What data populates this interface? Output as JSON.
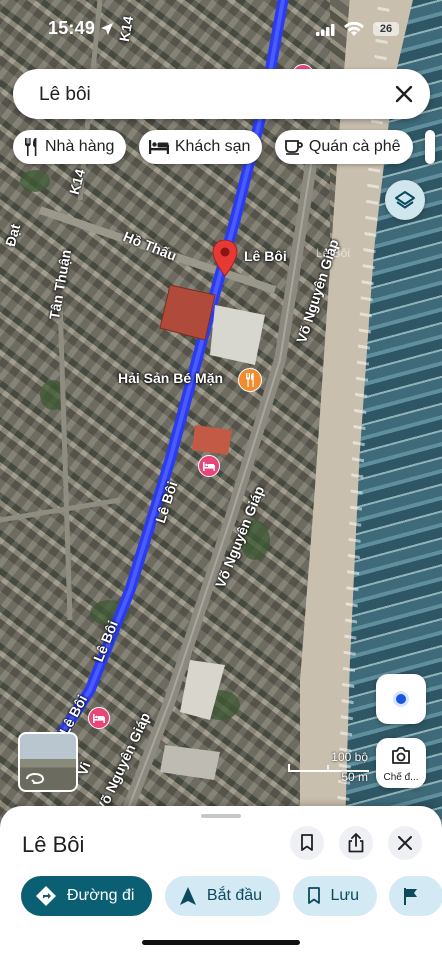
{
  "status_bar": {
    "time": "15:49",
    "battery": "26"
  },
  "search": {
    "value": "Lê bôi"
  },
  "chips": [
    {
      "label": "Nhà hàng",
      "icon": "fork-knife-icon"
    },
    {
      "label": "Khách sạn",
      "icon": "bed-icon"
    },
    {
      "label": "Quán cà phê",
      "icon": "coffee-cup-icon"
    }
  ],
  "map": {
    "pin_label": "Lê Bôi",
    "poi_restaurant": "Hải Sản Bé Mặn",
    "streets": {
      "le_boi_1": "Lê Bôi",
      "le_boi_2": "Lê Bôi",
      "le_boi_3": "Lê Bôi",
      "vo_nguyen_giap_1": "Võ Nguyên Giáp",
      "vo_nguyen_giap_2": "Võ Nguyên Giáp",
      "vo_nguyen_giap_3": "Võ Nguyên Giáp",
      "ho_thau": "Hồ Thấu",
      "tan_thuan": "Tân Thuận",
      "k14": "K14",
      "k14_2": "K14",
      "dat": "Đạt",
      "vi": "Vi"
    },
    "watermark": "Lê Bôi",
    "scale": {
      "feet": "100 bộ",
      "meters": "50 m"
    },
    "lens_label": "Chế đ..."
  },
  "sheet": {
    "title": "Lê Bôi",
    "actions": [
      {
        "label": "Đường đi",
        "icon": "directions-icon"
      },
      {
        "label": "Bắt đầu",
        "icon": "navigation-arrow-icon"
      },
      {
        "label": "Lưu",
        "icon": "bookmark-icon"
      },
      {
        "label": "",
        "icon": "flag-icon"
      }
    ]
  },
  "colors": {
    "route": "#2b3cf0",
    "pin": "#e53935",
    "primary_button": "#0b5f73",
    "action_chip": "#d3e9f3",
    "poi_orange": "#f28b2c",
    "hotel_pink": "#e8457a"
  }
}
